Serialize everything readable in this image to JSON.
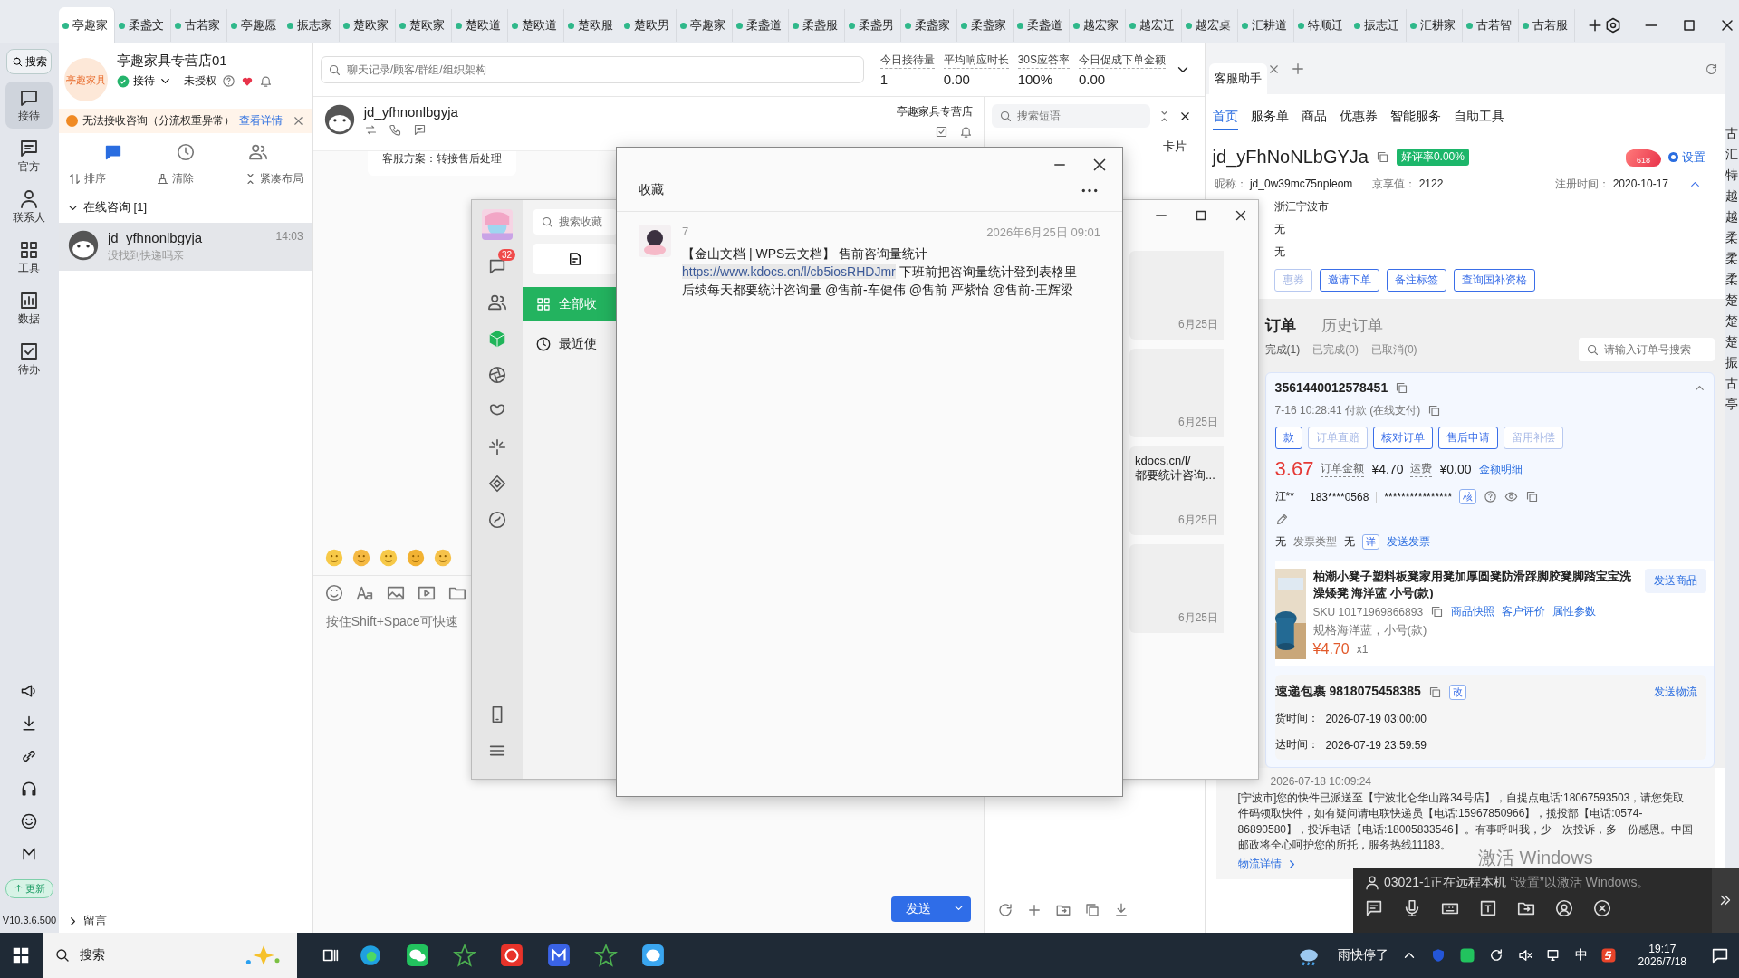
{
  "tabs": [
    {
      "label": "亭趣家",
      "selected": true
    },
    {
      "label": "柔盏文",
      "selected": false
    },
    {
      "label": "古若家",
      "selected": false
    },
    {
      "label": "亭趣愿",
      "selected": false
    },
    {
      "label": "振志家",
      "selected": false
    },
    {
      "label": "楚欧家",
      "selected": false
    },
    {
      "label": "楚欧家",
      "selected": false
    },
    {
      "label": "楚欧道",
      "selected": false
    },
    {
      "label": "楚欧道",
      "selected": false
    },
    {
      "label": "楚欧服",
      "selected": false
    },
    {
      "label": "楚欧男",
      "selected": false
    },
    {
      "label": "亭趣家",
      "selected": false
    },
    {
      "label": "柔盏道",
      "selected": false
    },
    {
      "label": "柔盏服",
      "selected": false
    },
    {
      "label": "柔盏男",
      "selected": false
    },
    {
      "label": "柔盏家",
      "selected": false
    },
    {
      "label": "柔盏家",
      "selected": false
    },
    {
      "label": "柔盏道",
      "selected": false
    },
    {
      "label": "越宏家",
      "selected": false
    },
    {
      "label": "越宏迁",
      "selected": false
    },
    {
      "label": "越宏桌",
      "selected": false
    },
    {
      "label": "汇耕道",
      "selected": false
    },
    {
      "label": "特顺迁",
      "selected": false
    },
    {
      "label": "振志迁",
      "selected": false
    },
    {
      "label": "汇耕家",
      "selected": false
    },
    {
      "label": "古若智",
      "selected": false
    },
    {
      "label": "古若服",
      "selected": false
    }
  ],
  "rail": {
    "search": "搜索",
    "items": [
      {
        "label": "接待",
        "selected": true
      },
      {
        "label": "官方",
        "selected": false
      },
      {
        "label": "联系人",
        "selected": false
      },
      {
        "label": "工具",
        "selected": false
      },
      {
        "label": "数据",
        "selected": false
      },
      {
        "label": "待办",
        "selected": false
      }
    ],
    "update": "更新",
    "version": "V10.3.6.500"
  },
  "store": {
    "logo": "亭趣家具",
    "name": "亭趣家具专营店01",
    "status": "接待",
    "auth": "未授权"
  },
  "alert": {
    "text": "无法接收咨询（分流权重异常）",
    "link": "查看详情"
  },
  "list_tabs": [
    {
      "selected": true
    },
    {
      "selected": false
    },
    {
      "selected": false
    }
  ],
  "list_actions": [
    "排序",
    "清除",
    "紧凑布局"
  ],
  "group": {
    "label": "在线咨询 [1]",
    "expanded": true
  },
  "conversations": [
    {
      "name": "jd_yfhnonlbgyja",
      "time": "14:03",
      "preview": "没找到快递吗亲",
      "selected": true
    }
  ],
  "footer_group": {
    "label": "留言",
    "expanded": false
  },
  "chat": {
    "search_placeholder": "聊天记录/顾客/群组/组织架构",
    "stats": [
      {
        "label": "今日接待量",
        "value": "1"
      },
      {
        "label": "平均响应时长",
        "value": "0.00"
      },
      {
        "label": "30S应答率",
        "value": "100%"
      },
      {
        "label": "今日促成下单金额",
        "value": "0.00"
      }
    ],
    "customer": "jd_yfhnonlbgyja",
    "store": "亭趣家具专营店",
    "message": "客服方案：转接售后处理",
    "input_placeholder": "按住Shift+Space可快速",
    "send": "发送"
  },
  "phrases": {
    "search_placeholder": "搜索短语",
    "tab": "卡片"
  },
  "wechat": {
    "badge": "32",
    "search_placeholder": "搜索收藏",
    "menu": [
      {
        "label": "全部收",
        "selected": true
      },
      {
        "label": "最近使",
        "selected": false
      }
    ],
    "cards": [
      {
        "date": "6月25日"
      },
      {
        "date": "6月25日"
      },
      {
        "lines": [
          "kdocs.cn/l/",
          "都要统计咨询..."
        ],
        "date": "6月25日"
      },
      {
        "date": "6月25日"
      }
    ]
  },
  "popup": {
    "title": "收藏",
    "sender": "7",
    "time": "2026年6月25日 09:01",
    "line1": "【金山文档 | WPS云文档】 售前咨询量统计",
    "link": "https://www.kdocs.cn/l/cb5iosRHDJmr",
    "line2": "下班前把咨询量统计登到表格里",
    "line3": "后续每天都要统计咨询量 @售前-车健伟  @售前  严紫怡  @售前-王辉梁"
  },
  "assistant": {
    "tab": "客服助手",
    "nav": [
      {
        "label": "首页",
        "selected": true
      },
      {
        "label": "服务单",
        "selected": false
      },
      {
        "label": "商品",
        "selected": false
      },
      {
        "label": "优惠券",
        "selected": false
      },
      {
        "label": "智能服务",
        "selected": false
      },
      {
        "label": "自助工具",
        "selected": false
      }
    ],
    "customer": "jd_yFhNoNLbGYJa",
    "rating": "好评率0.00%",
    "promo": "618",
    "setting": {
      "label": "设置",
      "checked": true
    },
    "info": [
      {
        "label": "昵称：",
        "value": "jd_0w39mc75npleom"
      },
      {
        "label": "京享值：",
        "value": "2122"
      },
      {
        "label": "注册时间：",
        "value": "2020-10-17"
      }
    ],
    "region": "浙江宁波市",
    "lines": [
      "无",
      "无"
    ],
    "actions": [
      {
        "label": "惠券",
        "disabled": true
      },
      {
        "label": "邀请下单",
        "disabled": false
      },
      {
        "label": "备注标签",
        "disabled": false
      },
      {
        "label": "查询国补资格",
        "disabled": false
      }
    ],
    "order_tabs": [
      {
        "label": "订单",
        "selected": true
      },
      {
        "label": "历史订单",
        "selected": false
      }
    ],
    "order_filters": [
      {
        "label": "完成(1)",
        "selected": true
      },
      {
        "label": "已完成(0)",
        "selected": false
      },
      {
        "label": "已取消(0)",
        "selected": false
      }
    ],
    "order_search_placeholder": "请输入订单号搜索",
    "order": {
      "id": "3561440012578451",
      "paid": "7-16 10:28:41  付款  (在线支付)",
      "buttons": [
        {
          "label": "款",
          "disabled": false
        },
        {
          "label": "订单直赔",
          "disabled": true
        },
        {
          "label": "核对订单",
          "disabled": false
        },
        {
          "label": "售后申请",
          "disabled": false
        },
        {
          "label": "留用补偿",
          "disabled": true
        }
      ],
      "price": "3.67",
      "amount_label": "订单金额",
      "amount": "¥4.70",
      "freight_label": "运费",
      "freight": "¥0.00",
      "detail_link": "金额明细",
      "name": "江**",
      "phone": "183****0568",
      "address": "****************",
      "verify": "核",
      "invoice": "无",
      "invoice_type_label": "发票类型",
      "invoice_type": "无",
      "invoice_detail": "详",
      "send_invoice": "发送发票"
    },
    "product": {
      "title": "柏潮小凳子塑料板凳家用凳加厚圆凳防滑踩脚胶凳脚踏宝宝洗澡矮凳 海洋蓝 小号(款)",
      "sku": "SKU 10171969866893",
      "links": [
        "商品快照",
        "客户评价",
        "属性参数"
      ],
      "spec": "规格海洋蓝，小号(款)",
      "price": "¥4.70",
      "qty": "x1",
      "send": "发送商品"
    },
    "logistics": {
      "title": "速递包裹 9818075458385",
      "edit": "改",
      "send": "发送物流",
      "rows": [
        {
          "label": "货时间：",
          "value": "2026-07-19 03:00:00"
        },
        {
          "label": "达时间：",
          "value": "2026-07-19 23:59:59"
        }
      ],
      "time": "2026-07-18 10:09:24",
      "text": "[宁波市]您的快件已派送至【宁波北仑华山路34号店】，自提点电话:18067593503，请您凭取件码领取快件，如有疑问请电联快递员【电话:15967850966】，揽投部【电话:0574-86890580】，投诉电话【电话:18005833546】。有事呼叫我，少一次投诉，多一份感恩。中国邮政将全心呵护您的所托，服务热线11183。",
      "detail": "物流详情"
    }
  },
  "side_strip": [
    "古",
    "汇",
    "特",
    "越",
    "越",
    "柔",
    "柔",
    "柔",
    "楚",
    "楚",
    "楚",
    "振",
    "古",
    "亭"
  ],
  "remote": {
    "text": "03021-1正在远程本机"
  },
  "activation": {
    "title": "激活 Windows",
    "hint": "“设置”以激活 Windows。"
  },
  "taskbar": {
    "search": "搜索",
    "weather": "雨快停了",
    "ime": "中",
    "time": "19:17",
    "date": "2026/7/18"
  }
}
